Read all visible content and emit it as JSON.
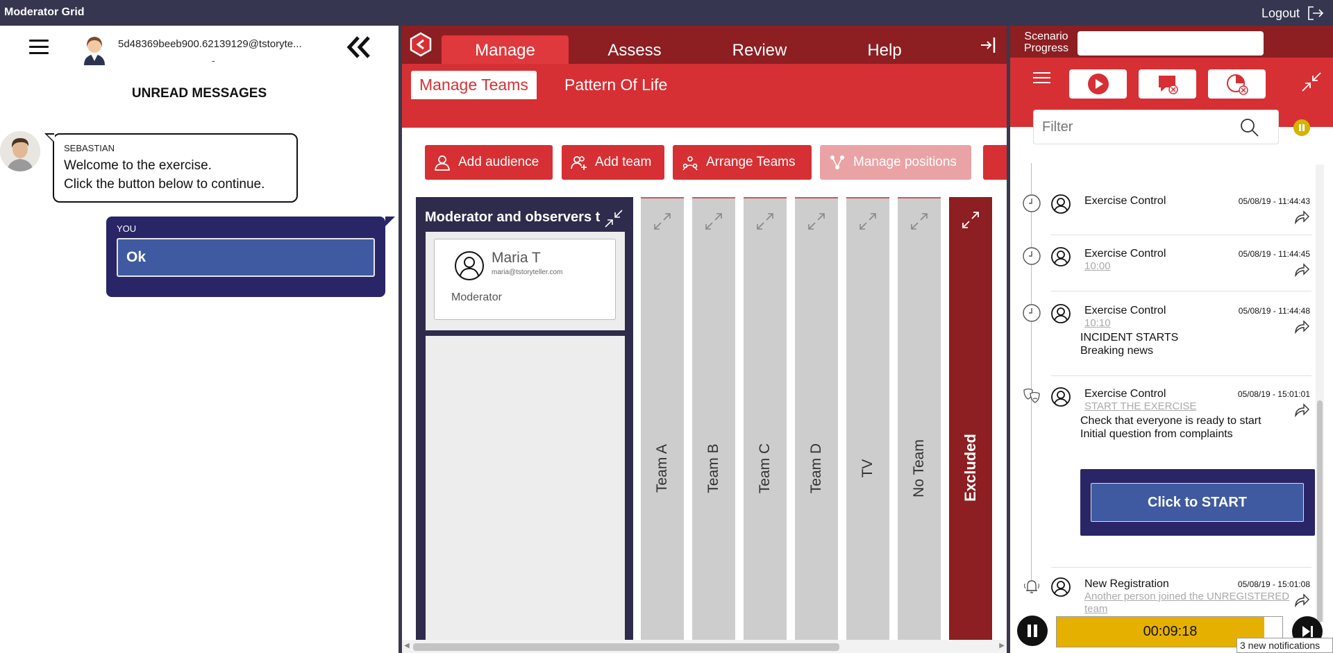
{
  "app": {
    "title": "Moderator Grid",
    "logout_label": "Logout"
  },
  "left": {
    "user_email": "5d48369beeb900.62139129@tstoryte...",
    "user_sub": "-",
    "unread_title": "UNREAD MESSAGES",
    "incoming": {
      "sender": "SEBASTIAN",
      "lines": [
        "Welcome to the exercise.",
        "Click the button below to continue."
      ]
    },
    "outgoing": {
      "sender": "YOU",
      "button_label": "Ok"
    }
  },
  "mid": {
    "nav_tabs": [
      "Manage",
      "Assess",
      "Review",
      "Help"
    ],
    "active_nav": "Manage",
    "sub_tabs": [
      "Manage Teams",
      "Pattern Of Life"
    ],
    "active_sub": "Manage Teams",
    "toolbar": {
      "add_audience": "Add audience",
      "add_team": "Add team",
      "arrange_teams": "Arrange Teams",
      "manage_positions": "Manage positions"
    },
    "moderator_panel": {
      "title": "Moderator and observers t",
      "member": {
        "name": "Maria T",
        "email": "maria@tstoryteller.com",
        "role": "Moderator"
      }
    },
    "teams": [
      "Team A",
      "Team B",
      "Team C",
      "Team D",
      "TV",
      "No Team"
    ],
    "excluded_label": "Excluded"
  },
  "right": {
    "scenario_progress_label": "Scenario Progress",
    "filter_placeholder": "Filter",
    "feed": [
      {
        "source": "Exercise Control",
        "timestamp": "05/08/19 - 11:44:43",
        "link": "",
        "body": []
      },
      {
        "source": "Exercise Control",
        "timestamp": "05/08/19 - 11:44:45",
        "link": "10:00",
        "body": []
      },
      {
        "source": "Exercise Control",
        "timestamp": "05/08/19 - 11:44:48",
        "link": "10:10",
        "body": [
          "INCIDENT STARTS",
          "Breaking news"
        ]
      },
      {
        "source": "Exercise Control",
        "timestamp": "05/08/19 - 15:01:01",
        "link": "START THE EXERCISE",
        "body": [
          "Check that everyone is ready to start",
          "Initial question from complaints"
        ],
        "button": "Click to START"
      },
      {
        "source": "New Registration",
        "timestamp": "05/08/19 - 15:01:08",
        "link": "Another person joined the UNREGISTERED",
        "link2": "team",
        "body": []
      }
    ],
    "timer": {
      "value": "00:09:18",
      "progress_percent": 92
    },
    "notifications": "3 new notifications",
    "colors": {
      "dark_red": "#8d1e22",
      "red": "#d63034",
      "navy": "#2a2566",
      "timer": "#e5b000"
    }
  }
}
